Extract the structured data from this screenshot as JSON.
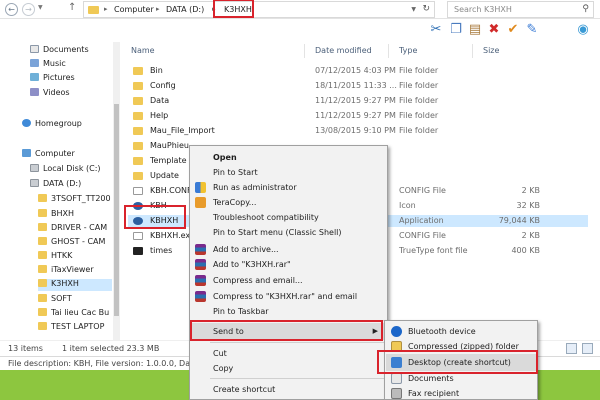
{
  "address_bar": {
    "crumbs": [
      "Computer",
      "DATA (D:)",
      "K3HXH"
    ],
    "search_placeholder": "Search K3HXH"
  },
  "toolbar_icons": [
    "scissors-icon",
    "copy-icon",
    "paste-icon",
    "delete-icon",
    "checkmark-icon",
    "rename-icon",
    "globe-icon"
  ],
  "nav_pane": {
    "items": [
      {
        "label": "Documents",
        "icon": "documents-icon"
      },
      {
        "label": "Music",
        "icon": "music-icon"
      },
      {
        "label": "Pictures",
        "icon": "pictures-icon"
      },
      {
        "label": "Videos",
        "icon": "videos-icon"
      },
      {
        "label": "Homegroup",
        "icon": "homegroup-icon"
      },
      {
        "label": "Computer",
        "icon": "computer-icon"
      },
      {
        "label": "Local Disk (C:)",
        "icon": "drive-icon"
      },
      {
        "label": "DATA (D:)",
        "icon": "drive-icon"
      },
      {
        "label": "3TSOFT_TT200",
        "icon": "folder-icon"
      },
      {
        "label": "BHXH",
        "icon": "folder-icon"
      },
      {
        "label": "DRIVER - CAM",
        "icon": "folder-icon"
      },
      {
        "label": "GHOST - CAM",
        "icon": "folder-icon"
      },
      {
        "label": "HTKK",
        "icon": "folder-icon"
      },
      {
        "label": "iTaxViewer",
        "icon": "folder-icon"
      },
      {
        "label": "K3HXH",
        "icon": "folder-icon"
      },
      {
        "label": "SOFT",
        "icon": "folder-icon"
      },
      {
        "label": "Tai lieu Cac Bu",
        "icon": "folder-icon"
      },
      {
        "label": "TEST LAPTOP",
        "icon": "folder-icon"
      }
    ]
  },
  "file_list": {
    "headers": {
      "name": "Name",
      "date": "Date modified",
      "type": "Type",
      "size": "Size"
    },
    "rows": [
      {
        "name": "Bin",
        "date": "07/12/2015 4:03 PM",
        "type": "File folder",
        "size": ""
      },
      {
        "name": "Config",
        "date": "18/11/2015 11:33 ...",
        "type": "File folder",
        "size": ""
      },
      {
        "name": "Data",
        "date": "11/12/2015 9:27 PM",
        "type": "File folder",
        "size": ""
      },
      {
        "name": "Help",
        "date": "11/12/2015 9:27 PM",
        "type": "File folder",
        "size": ""
      },
      {
        "name": "Mau_File_Import",
        "date": "13/08/2015 9:10 PM",
        "type": "File folder",
        "size": ""
      },
      {
        "name": "MauPhieu",
        "date": "",
        "type": "",
        "size": ""
      },
      {
        "name": "Template",
        "date": "",
        "type": "",
        "size": ""
      },
      {
        "name": "Update",
        "date": "",
        "type": "",
        "size": ""
      },
      {
        "name": "KBH.CONF",
        "date": "",
        "type": "CONFIG File",
        "size": "2 KB"
      },
      {
        "name": "KBH",
        "date": "",
        "type": "Icon",
        "size": "32 KB"
      },
      {
        "name": "KBHXH",
        "date": "",
        "type": "Application",
        "size": "79,044 KB"
      },
      {
        "name": "KBHXH.exe",
        "date": "",
        "type": "CONFIG File",
        "size": "2 KB"
      },
      {
        "name": "times",
        "date": "",
        "type": "TrueType font file",
        "size": "400 KB"
      }
    ]
  },
  "status": {
    "items": "13 items",
    "selected": "1 item selected  23.3 MB",
    "detail": "File description: KBH, File version: 1.0.0.0, Date c"
  },
  "context_menu": {
    "items": [
      {
        "label": "Open",
        "icon": ""
      },
      {
        "label": "Pin to Start",
        "icon": ""
      },
      {
        "label": "Run as administrator",
        "icon": "shield-icon"
      },
      {
        "label": "TeraCopy...",
        "icon": "teracopy-icon"
      },
      {
        "label": "Troubleshoot compatibility",
        "icon": ""
      },
      {
        "label": "Pin to Start menu (Classic Shell)",
        "icon": ""
      },
      {
        "label": "Add to archive...",
        "icon": "winrar-icon"
      },
      {
        "label": "Add to \"K3HXH.rar\"",
        "icon": "winrar-icon"
      },
      {
        "label": "Compress and email...",
        "icon": "winrar-icon"
      },
      {
        "label": "Compress to \"K3HXH.rar\" and email",
        "icon": "winrar-icon"
      },
      {
        "label": "Pin to Taskbar",
        "icon": ""
      },
      {
        "label": "Send to",
        "icon": ""
      },
      {
        "label": "Cut",
        "icon": ""
      },
      {
        "label": "Copy",
        "icon": ""
      },
      {
        "label": "Create shortcut",
        "icon": ""
      }
    ]
  },
  "send_to_menu": {
    "items": [
      {
        "label": "Bluetooth device",
        "icon": "bluetooth-icon"
      },
      {
        "label": "Compressed (zipped) folder",
        "icon": "zip-folder-icon"
      },
      {
        "label": "Desktop (create shortcut)",
        "icon": "desktop-icon"
      },
      {
        "label": "Documents",
        "icon": "documents-icon"
      },
      {
        "label": "Fax recipient",
        "icon": "fax-icon"
      }
    ]
  },
  "colors": {
    "highlight_box": "#d9232c",
    "selection": "#cde8ff",
    "bottom_band": "#8dc63f"
  }
}
